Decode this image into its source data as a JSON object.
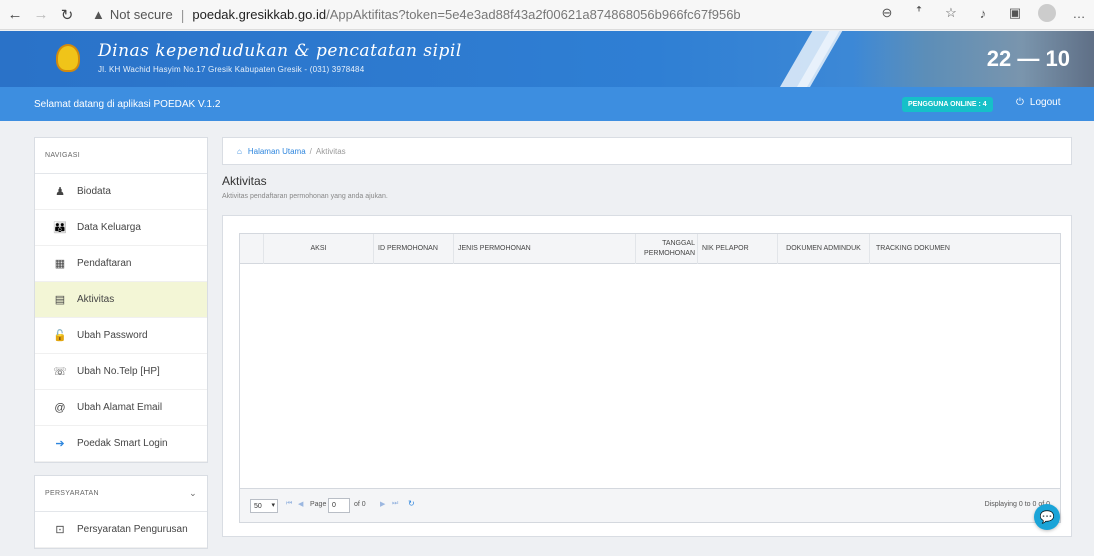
{
  "browser": {
    "security_label": "Not secure",
    "url_host": "poedak.gresikkab.go.id",
    "url_path": "/AppAktifitas?token=5e4e3ad88f43a2f00621a874868056b966fc67f956bd8eac19aa8..."
  },
  "header": {
    "org_title": "Dinas kependudukan & pencatatan sipil",
    "org_address": "Jl. KH Wachid Hasyim No.17 Gresik Kabupaten Gresik - (031) 3978484",
    "clock_day": "22",
    "clock_time": "10"
  },
  "welcome": {
    "text": "Selamat datang di aplikasi POEDAK V.1.2",
    "online_label": "PENGGUNA ONLINE : 4",
    "logout_label": "Logout"
  },
  "sidebar": {
    "nav_title": "NAVIGASI",
    "items": [
      {
        "label": "Biodata",
        "icon": "user-icon"
      },
      {
        "label": "Data Keluarga",
        "icon": "family-icon"
      },
      {
        "label": "Pendaftaran",
        "icon": "grid-icon"
      },
      {
        "label": "Aktivitas",
        "icon": "list-icon"
      },
      {
        "label": "Ubah Password",
        "icon": "lock-icon"
      },
      {
        "label": "Ubah No.Telp [HP]",
        "icon": "phone-icon"
      },
      {
        "label": "Ubah Alamat Email",
        "icon": "at-icon"
      },
      {
        "label": "Poedak Smart Login",
        "icon": "arrow-right-icon"
      }
    ],
    "req_title": "PERSYARATAN",
    "req_items": [
      {
        "label": "Persyaratan Pengurusan",
        "icon": "document-icon"
      }
    ]
  },
  "main": {
    "breadcrumb_home": "Halaman Utama",
    "breadcrumb_current": "Aktivitas",
    "title": "Aktivitas",
    "subtitle": "Aktivitas pendaftaran permohonan yang anda ajukan.",
    "columns": [
      "AKSI",
      "ID PERMOHONAN",
      "JENIS PERMOHONAN",
      "TANGGAL PERMOHONAN",
      "NIK PELAPOR",
      "DOKUMEN ADMINDUK",
      "TRACKING DOKUMEN"
    ],
    "pager": {
      "page_size": "50",
      "page_label": "Page",
      "page_value": "0",
      "of_label": "of 0",
      "displaying": "Displaying 0 to 0 of 0"
    }
  },
  "colors": {
    "header_blue": "#2f7fd4",
    "welcome_blue": "#3d8ee0",
    "active_item_bg": "#f3f6d6",
    "online_pill": "#16c0c8"
  }
}
